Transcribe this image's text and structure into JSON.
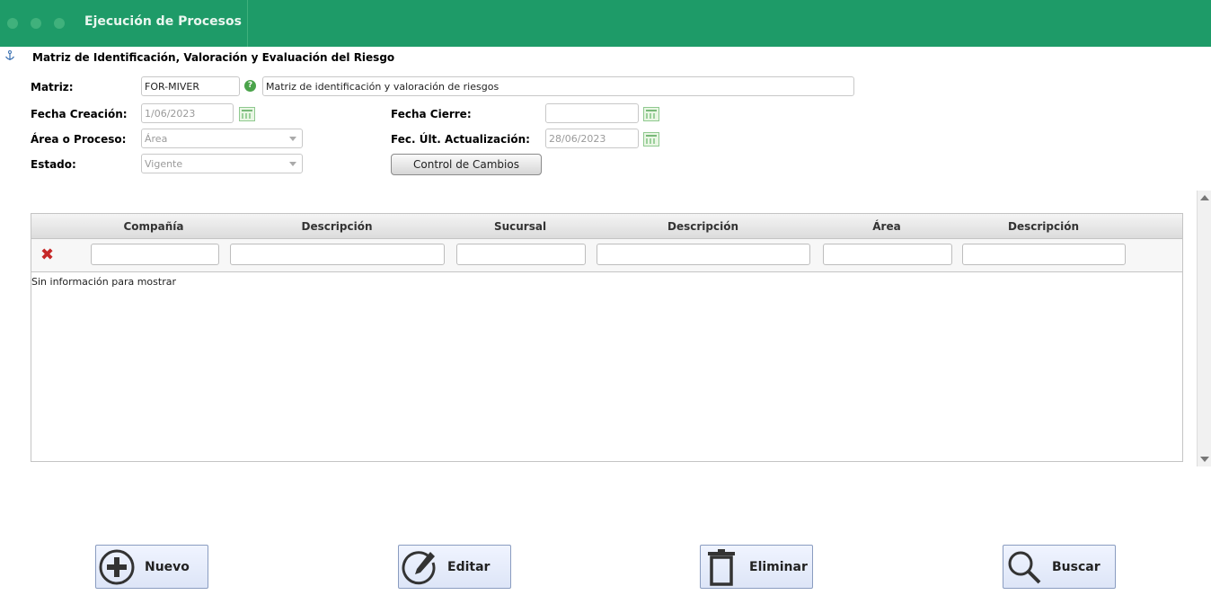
{
  "window": {
    "title": "Ejecución de Procesos"
  },
  "section": {
    "title": "Matriz de Identificación, Valoración y Evaluación del Riesgo"
  },
  "form": {
    "matriz_label": "Matriz:",
    "matriz_code": "FOR-MIVER",
    "matriz_desc": "Matriz de identificación y valoración de riesgos",
    "fecha_creacion_label": "Fecha Creación:",
    "fecha_creacion": "1/06/2023",
    "fecha_cierre_label": "Fecha Cierre:",
    "fecha_cierre": "",
    "area_label": "Área o Proceso:",
    "area_value": "Área",
    "fec_ult_label": "Fec. Últ. Actualización:",
    "fec_ult": "28/06/2023",
    "estado_label": "Estado:",
    "estado_value": "Vigente",
    "control_cambios": "Control de Cambios"
  },
  "grid": {
    "columns": [
      "Compañía",
      "Descripción",
      "Sucursal",
      "Descripción",
      "Área",
      "Descripción"
    ],
    "empty_message": "Sin información para mostrar"
  },
  "actions": {
    "nuevo": "Nuevo",
    "editar": "Editar",
    "eliminar": "Eliminar",
    "buscar": "Buscar"
  },
  "colors": {
    "titlebar": "#1e9b68",
    "danger": "#c62828"
  }
}
